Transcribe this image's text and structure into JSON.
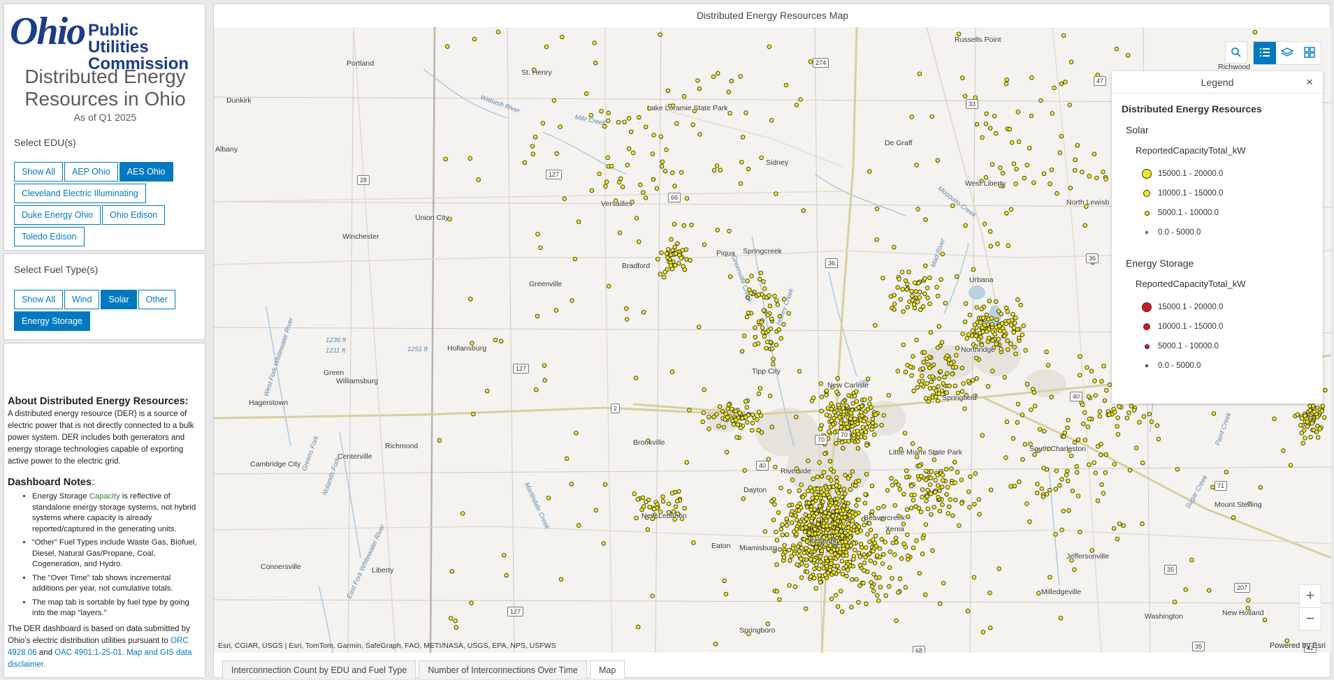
{
  "header": {
    "logo_word": "Ohio",
    "logo_line1": "Public Utilities",
    "logo_line2": "Commission",
    "title": "Distributed Energy Resources in Ohio",
    "subtitle": "As of Q1 2025"
  },
  "edu": {
    "label": "Select EDU(s)",
    "buttons": [
      {
        "label": "Show All",
        "active": false
      },
      {
        "label": "AEP Ohio",
        "active": false
      },
      {
        "label": "AES Ohio",
        "active": true
      },
      {
        "label": "Cleveland Electric Illuminating",
        "active": false
      },
      {
        "label": "Duke Energy Ohio",
        "active": false
      },
      {
        "label": "Ohio Edison",
        "active": false
      },
      {
        "label": "Toledo Edison",
        "active": false
      }
    ]
  },
  "fuel": {
    "label": "Select Fuel Type(s)",
    "buttons": [
      {
        "label": "Show All",
        "active": false
      },
      {
        "label": "Wind",
        "active": false
      },
      {
        "label": "Solar",
        "active": true
      },
      {
        "label": "Other",
        "active": false
      },
      {
        "label": "Energy Storage",
        "active": true
      }
    ]
  },
  "about": {
    "heading": "About Distributed Energy Resources:",
    "text": "A distributed energy resource (DER) is a source of electric power that is not directly connected to a bulk power system. DER includes both generators and energy storage technologies capable of exporting active power to the electric grid.",
    "notes_heading": "Dashboard Notes",
    "notes_colon": ":",
    "note1_a": "Energy Storage ",
    "note1_b": "Capacity",
    "note1_c": " is reflective of standalone energy storage systems, not hybrid systems where capacity is already reported/captured in the generating units.",
    "note2": "“Other” Fuel Types include Waste Gas, Biofuel, Diesel, Natural Gas/Propane, Coal, Cogeneration, and Hydro.",
    "note3": "The \"Over Time\" tab shows incremental additions per year, not cumulative totals.",
    "note4": "The map tab is sortable by fuel type by going into the map \"layers.\"",
    "footer_a": "The DER dashboard is based on data submitted by Ohio’s electric distribution utilities pursuant to ",
    "footer_link1": "ORC 4928.06",
    "footer_b": " and ",
    "footer_link2": "OAC 4901:1-25-01",
    "footer_c": ". ",
    "footer_link3": "Map and GIS data disclaimer."
  },
  "map": {
    "title": "Distributed Energy Resources Map",
    "attribution": "Esri, CGIAR, USGS | Esri, TomTom, Garmin, SafeGraph, FAO, METI/NASA, USGS, EPA, NPS, USFWS",
    "powered_by": "Powered by Esri",
    "places": [
      "Russells Point",
      "Portland",
      "St. Henry",
      "Richwood",
      "Dunkirk",
      "Lake Loramie State Park",
      "Albany",
      "De Graff",
      "Sidney",
      "West Liberty",
      "North Lewisb",
      "Versailles",
      "Union City",
      "Winchester",
      "Bradford",
      "Piqua",
      "Springcreek",
      "Greenville",
      "Urbana",
      "Hollansburg",
      "Northridge",
      "Green",
      "Williamsburg",
      "Tipp City",
      "New Carlisle",
      "Springfield",
      "Hagerstown",
      "Brookville",
      "Richmond",
      "Cambridge City",
      "Centerville",
      "South Charleston",
      "Little Miami State Park",
      "Riverside",
      "Dayton",
      "New Lebanon",
      "Mount Sterling",
      "Xenia",
      "Connersville",
      "Liberty",
      "Jeffersonville",
      "Milledgeville",
      "New Holland",
      "Washington",
      "Eaton",
      "Kettering",
      "Miamisburg",
      "Springboro",
      "Beavercreek"
    ],
    "water": [
      "Wabash River",
      "Mile Creek",
      "Mosquito Creek",
      "Mad River",
      "Greenville Creek",
      "Honey Creek",
      "West Fork Whitewater River",
      "Greens Fork",
      "Nolands Fork",
      "Martindale Creek",
      "East Fork Whitewater River",
      "Paint Creek",
      "Sugar Creek"
    ],
    "elevations": [
      "1236 ft",
      "1211 ft",
      "1251 ft"
    ],
    "shields": [
      "274",
      "33",
      "47",
      "28",
      "127",
      "66",
      "36",
      "36",
      "127",
      "2",
      "40",
      "70",
      "70",
      "40",
      "70",
      "71",
      "127",
      "35",
      "207",
      "68",
      "35",
      "42"
    ]
  },
  "legend": {
    "title": "Legend",
    "close": "×",
    "layer": "Distributed Energy Resources",
    "groups": [
      {
        "name": "Solar",
        "field": "ReportedCapacityTotal_kW",
        "color": "#f2ea19",
        "classes": [
          "15000.1 - 20000.0",
          "10000.1 - 15000.0",
          "5000.1 - 10000.0",
          "0.0 - 5000.0"
        ]
      },
      {
        "name": "Energy Storage",
        "field": "ReportedCapacityTotal_kW",
        "color": "#d7191c",
        "classes": [
          "15000.1 - 20000.0",
          "10000.1 - 15000.0",
          "5000.1 - 10000.0",
          "0.0 - 5000.0"
        ]
      }
    ]
  },
  "tabs": [
    {
      "label": "Interconnection Count by EDU and Fuel Type",
      "active": false
    },
    {
      "label": "Number of Interconnections Over Time",
      "active": false
    },
    {
      "label": "Map",
      "active": true
    }
  ],
  "colors": {
    "accent": "#0079c1",
    "solar": "#f2ea19",
    "storage": "#d7191c"
  },
  "icons": [
    "search-icon",
    "legend-list-icon",
    "layers-icon",
    "basemap-gallery-icon",
    "zoom-in-icon",
    "zoom-out-icon",
    "close-icon"
  ]
}
